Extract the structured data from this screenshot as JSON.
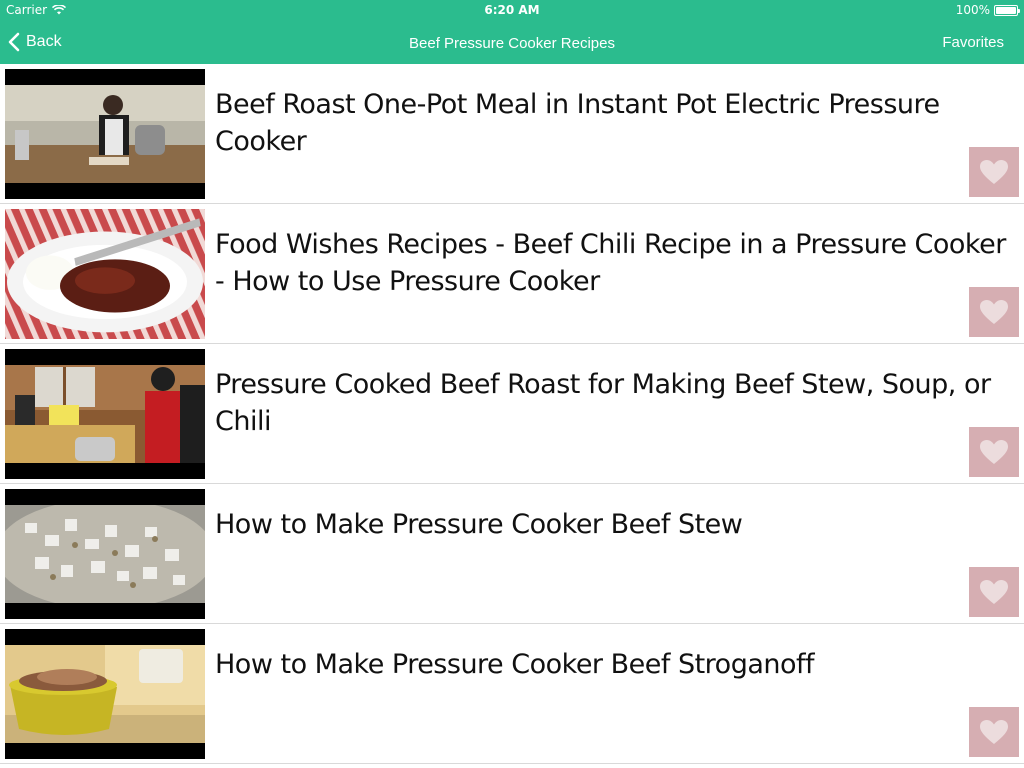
{
  "status_bar": {
    "carrier": "Carrier",
    "time": "6:20 AM",
    "battery": "100%",
    "battery_level": 1.0
  },
  "nav": {
    "back_label": "Back",
    "title": "Beef Pressure Cooker Recipes",
    "favorites_label": "Favorites"
  },
  "colors": {
    "accent": "#2bbc8e",
    "favorite_button": "#d6aeb2"
  },
  "videos": [
    {
      "title": "Beef Roast One-Pot Meal in Instant Pot Electric Pressure Cooker",
      "icon": "heart-icon"
    },
    {
      "title": "Food Wishes Recipes - Beef Chili Recipe in a Pressure Cooker - How to Use Pressure Cooker",
      "icon": "heart-icon"
    },
    {
      "title": "Pressure Cooked Beef Roast for Making Beef Stew, Soup, or Chili",
      "icon": "heart-icon"
    },
    {
      "title": "How to Make Pressure Cooker Beef Stew",
      "icon": "heart-icon"
    },
    {
      "title": "How to Make Pressure Cooker Beef Stroganoff",
      "icon": "heart-icon"
    }
  ]
}
